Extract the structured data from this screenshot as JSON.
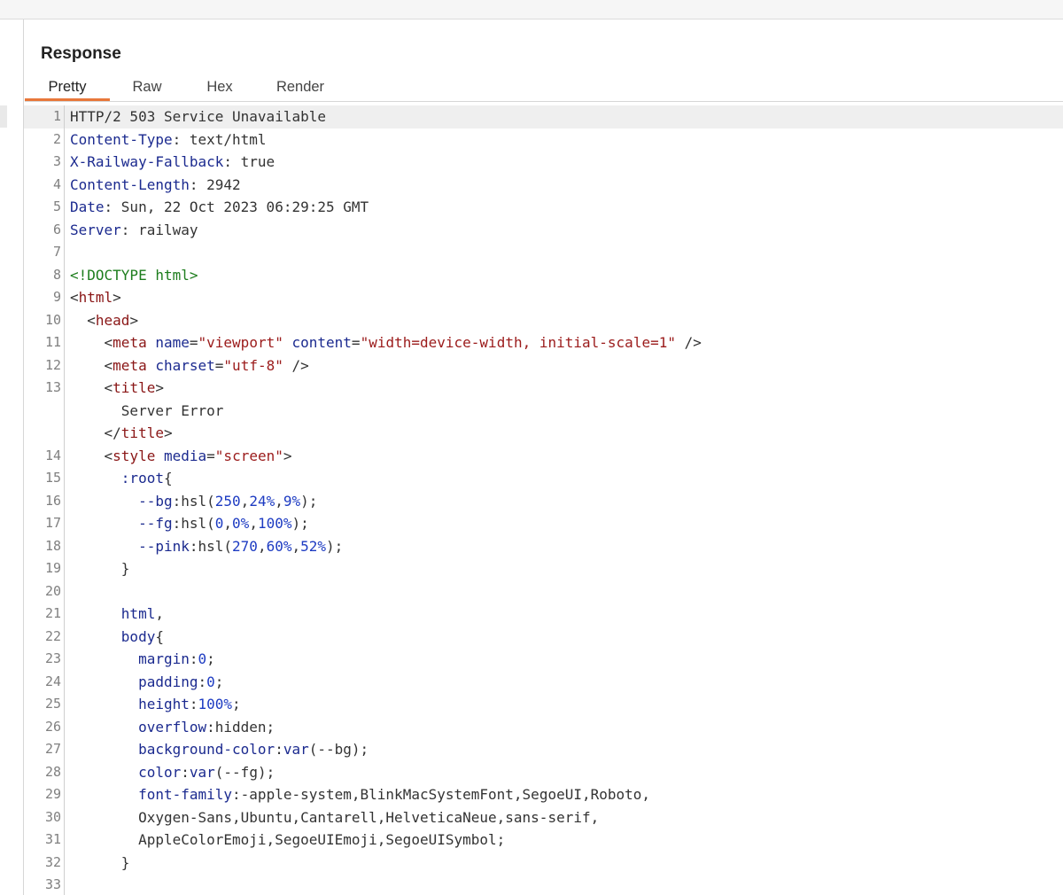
{
  "panel": {
    "title": "Response"
  },
  "tabs": [
    {
      "label": "Pretty",
      "active": true
    },
    {
      "label": "Raw",
      "active": false
    },
    {
      "label": "Hex",
      "active": false
    },
    {
      "label": "Render",
      "active": false
    }
  ],
  "lines": [
    {
      "n": "1",
      "current": true,
      "segs": [
        {
          "t": "HTTP/2 503 Service Unavailable",
          "c": "pl"
        }
      ]
    },
    {
      "n": "2",
      "segs": [
        {
          "t": "Content-Type",
          "c": "hk"
        },
        {
          "t": ": text/html",
          "c": "pl"
        }
      ]
    },
    {
      "n": "3",
      "segs": [
        {
          "t": "X-Railway-Fallback",
          "c": "hk"
        },
        {
          "t": ": true",
          "c": "pl"
        }
      ]
    },
    {
      "n": "4",
      "segs": [
        {
          "t": "Content-Length",
          "c": "hk"
        },
        {
          "t": ": 2942",
          "c": "pl"
        }
      ]
    },
    {
      "n": "5",
      "segs": [
        {
          "t": "Date",
          "c": "hk"
        },
        {
          "t": ": Sun, 22 Oct 2023 06:29:25 GMT",
          "c": "pl"
        }
      ]
    },
    {
      "n": "6",
      "segs": [
        {
          "t": "Server",
          "c": "hk"
        },
        {
          "t": ": railway",
          "c": "pl"
        }
      ]
    },
    {
      "n": "7",
      "segs": []
    },
    {
      "n": "8",
      "segs": [
        {
          "t": "<!DOCTYPE html>",
          "c": "dt"
        }
      ]
    },
    {
      "n": "9",
      "segs": [
        {
          "t": "<",
          "c": "pl"
        },
        {
          "t": "html",
          "c": "tg"
        },
        {
          "t": ">",
          "c": "pl"
        }
      ]
    },
    {
      "n": "10",
      "segs": [
        {
          "t": "  <",
          "c": "pl"
        },
        {
          "t": "head",
          "c": "tg"
        },
        {
          "t": ">",
          "c": "pl"
        }
      ]
    },
    {
      "n": "11",
      "segs": [
        {
          "t": "    <",
          "c": "pl"
        },
        {
          "t": "meta",
          "c": "tg"
        },
        {
          "t": " ",
          "c": "pl"
        },
        {
          "t": "name",
          "c": "at"
        },
        {
          "t": "=",
          "c": "pl"
        },
        {
          "t": "\"viewport\"",
          "c": "st"
        },
        {
          "t": " ",
          "c": "pl"
        },
        {
          "t": "content",
          "c": "at"
        },
        {
          "t": "=",
          "c": "pl"
        },
        {
          "t": "\"width=device-width, initial-scale=1\"",
          "c": "st"
        },
        {
          "t": " />",
          "c": "pl"
        }
      ]
    },
    {
      "n": "12",
      "segs": [
        {
          "t": "    <",
          "c": "pl"
        },
        {
          "t": "meta",
          "c": "tg"
        },
        {
          "t": " ",
          "c": "pl"
        },
        {
          "t": "charset",
          "c": "at"
        },
        {
          "t": "=",
          "c": "pl"
        },
        {
          "t": "\"utf-8\"",
          "c": "st"
        },
        {
          "t": " />",
          "c": "pl"
        }
      ]
    },
    {
      "n": "13",
      "segs": [
        {
          "t": "    <",
          "c": "pl"
        },
        {
          "t": "title",
          "c": "tg"
        },
        {
          "t": ">",
          "c": "pl"
        }
      ]
    },
    {
      "n": "",
      "sub": true,
      "segs": [
        {
          "t": "      Server Error",
          "c": "pl"
        }
      ]
    },
    {
      "n": "",
      "sub": true,
      "segs": [
        {
          "t": "    </",
          "c": "pl"
        },
        {
          "t": "title",
          "c": "tg"
        },
        {
          "t": ">",
          "c": "pl"
        }
      ]
    },
    {
      "n": "14",
      "segs": [
        {
          "t": "    <",
          "c": "pl"
        },
        {
          "t": "style",
          "c": "tg"
        },
        {
          "t": " ",
          "c": "pl"
        },
        {
          "t": "media",
          "c": "at"
        },
        {
          "t": "=",
          "c": "pl"
        },
        {
          "t": "\"screen\"",
          "c": "st"
        },
        {
          "t": ">",
          "c": "pl"
        }
      ]
    },
    {
      "n": "15",
      "segs": [
        {
          "t": "      :root",
          "c": "hk"
        },
        {
          "t": "{",
          "c": "pl"
        }
      ]
    },
    {
      "n": "16",
      "segs": [
        {
          "t": "        --bg",
          "c": "hk"
        },
        {
          "t": ":hsl(",
          "c": "pl"
        },
        {
          "t": "250",
          "c": "nm"
        },
        {
          "t": ",",
          "c": "pl"
        },
        {
          "t": "24%",
          "c": "nm"
        },
        {
          "t": ",",
          "c": "pl"
        },
        {
          "t": "9%",
          "c": "nm"
        },
        {
          "t": ");",
          "c": "pl"
        }
      ]
    },
    {
      "n": "17",
      "segs": [
        {
          "t": "        --fg",
          "c": "hk"
        },
        {
          "t": ":hsl(",
          "c": "pl"
        },
        {
          "t": "0",
          "c": "nm"
        },
        {
          "t": ",",
          "c": "pl"
        },
        {
          "t": "0%",
          "c": "nm"
        },
        {
          "t": ",",
          "c": "pl"
        },
        {
          "t": "100%",
          "c": "nm"
        },
        {
          "t": ");",
          "c": "pl"
        }
      ]
    },
    {
      "n": "18",
      "segs": [
        {
          "t": "        --pink",
          "c": "hk"
        },
        {
          "t": ":hsl(",
          "c": "pl"
        },
        {
          "t": "270",
          "c": "nm"
        },
        {
          "t": ",",
          "c": "pl"
        },
        {
          "t": "60%",
          "c": "nm"
        },
        {
          "t": ",",
          "c": "pl"
        },
        {
          "t": "52%",
          "c": "nm"
        },
        {
          "t": ");",
          "c": "pl"
        }
      ]
    },
    {
      "n": "19",
      "segs": [
        {
          "t": "      }",
          "c": "pl"
        }
      ]
    },
    {
      "n": "20",
      "segs": []
    },
    {
      "n": "21",
      "segs": [
        {
          "t": "      html",
          "c": "hk"
        },
        {
          "t": ",",
          "c": "pl"
        }
      ]
    },
    {
      "n": "22",
      "segs": [
        {
          "t": "      body",
          "c": "hk"
        },
        {
          "t": "{",
          "c": "pl"
        }
      ]
    },
    {
      "n": "23",
      "segs": [
        {
          "t": "        margin",
          "c": "hk"
        },
        {
          "t": ":",
          "c": "pl"
        },
        {
          "t": "0",
          "c": "nm"
        },
        {
          "t": ";",
          "c": "pl"
        }
      ]
    },
    {
      "n": "24",
      "segs": [
        {
          "t": "        padding",
          "c": "hk"
        },
        {
          "t": ":",
          "c": "pl"
        },
        {
          "t": "0",
          "c": "nm"
        },
        {
          "t": ";",
          "c": "pl"
        }
      ]
    },
    {
      "n": "25",
      "segs": [
        {
          "t": "        height",
          "c": "hk"
        },
        {
          "t": ":",
          "c": "pl"
        },
        {
          "t": "100%",
          "c": "nm"
        },
        {
          "t": ";",
          "c": "pl"
        }
      ]
    },
    {
      "n": "26",
      "segs": [
        {
          "t": "        overflow",
          "c": "hk"
        },
        {
          "t": ":hidden;",
          "c": "pl"
        }
      ]
    },
    {
      "n": "27",
      "segs": [
        {
          "t": "        background-color",
          "c": "hk"
        },
        {
          "t": ":",
          "c": "pl"
        },
        {
          "t": "var",
          "c": "hk"
        },
        {
          "t": "(--bg);",
          "c": "pl"
        }
      ]
    },
    {
      "n": "28",
      "segs": [
        {
          "t": "        color",
          "c": "hk"
        },
        {
          "t": ":",
          "c": "pl"
        },
        {
          "t": "var",
          "c": "hk"
        },
        {
          "t": "(--fg);",
          "c": "pl"
        }
      ]
    },
    {
      "n": "29",
      "segs": [
        {
          "t": "        font-family",
          "c": "hk"
        },
        {
          "t": ":-apple-system,BlinkMacSystemFont,SegoeUI,Roboto,",
          "c": "pl"
        }
      ]
    },
    {
      "n": "30",
      "segs": [
        {
          "t": "        Oxygen-Sans,Ubuntu,Cantarell,HelveticaNeue,sans-serif,",
          "c": "pl"
        }
      ]
    },
    {
      "n": "31",
      "segs": [
        {
          "t": "        AppleColorEmoji,SegoeUIEmoji,SegoeUISymbol;",
          "c": "pl"
        }
      ]
    },
    {
      "n": "32",
      "segs": [
        {
          "t": "      }",
          "c": "pl"
        }
      ]
    },
    {
      "n": "33",
      "segs": []
    }
  ]
}
